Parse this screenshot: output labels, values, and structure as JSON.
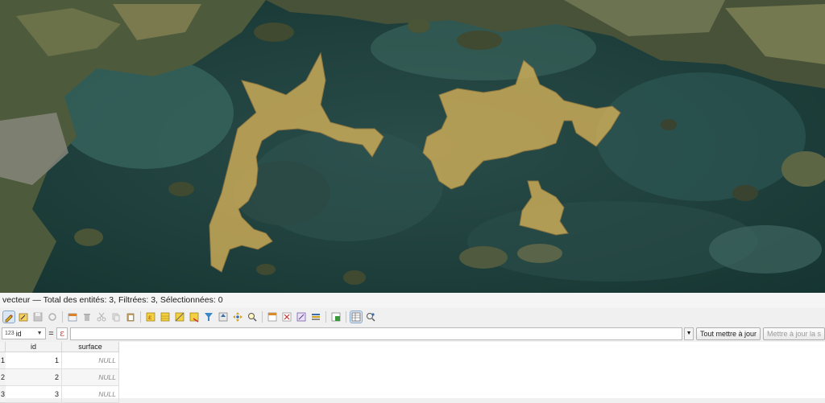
{
  "layer_status": "vecteur — Total des entités: 3, Filtrées: 3, Sélectionnées: 0",
  "toolbar": {
    "icons": [
      "pencil-icon",
      "multi-edit-icon",
      "save-icon",
      "reload-icon",
      "add-feature-icon",
      "delete-icon",
      "cut-icon",
      "copy-icon",
      "paste-icon",
      "expression-select-icon",
      "select-all-icon",
      "invert-selection-icon",
      "deselect-icon",
      "filter-select-icon",
      "move-selection-top-icon",
      "pan-to-selection-icon",
      "zoom-to-selection-icon",
      "new-field-icon",
      "delete-field-icon",
      "field-calculator-icon",
      "conditional-formatting-icon",
      "dock-icon",
      "table-view-icon",
      "form-view-icon"
    ]
  },
  "filter": {
    "field_type": "123",
    "field_name": "id",
    "operator": "=",
    "epsilon": "ε",
    "update_all_label": "Tout mettre à jour",
    "update_selected_label": "Mettre à jour la s"
  },
  "table": {
    "columns": [
      "id",
      "surface"
    ],
    "rows": [
      {
        "num": "1",
        "id": "1",
        "surface": "NULL"
      },
      {
        "num": "2",
        "id": "2",
        "surface": "NULL"
      },
      {
        "num": "3",
        "id": "3",
        "surface": "NULL"
      }
    ]
  },
  "colors": {
    "polygon_fill": "#d9b45a",
    "polygon_stroke": "#8a7440",
    "water": "#1e3f3d"
  }
}
